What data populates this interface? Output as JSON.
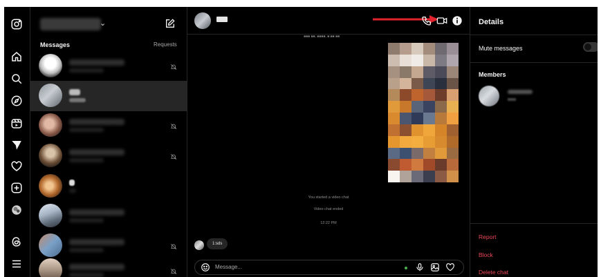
{
  "colors": {
    "background": "#000000",
    "border": "#262626",
    "accent_danger": "#ed4956",
    "annotation_arrow": "#e0232d"
  },
  "nav": {
    "icons": [
      "instagram-icon",
      "home-icon",
      "search-icon",
      "explore-icon",
      "reels-icon",
      "direct-icon",
      "heart-icon",
      "create-icon",
      "profile-icon",
      "threads-icon",
      "menu-icon"
    ]
  },
  "inbox": {
    "messages_label": "Messages",
    "requests_label": "Requests",
    "conversation_count": 9,
    "muted_rows": [
      1,
      3,
      4,
      7,
      8
    ],
    "active_row": 2
  },
  "chat": {
    "started_video": "You started a video chat",
    "video_ended": "Video chat ended",
    "time": "12:22 PM",
    "reply_preview": "1:sds",
    "composer_placeholder": "Message..."
  },
  "details": {
    "title": "Details",
    "mute_label": "Mute messages",
    "mute_on": false,
    "members_label": "Members",
    "actions": [
      "Report",
      "Block",
      "Delete chat"
    ]
  }
}
